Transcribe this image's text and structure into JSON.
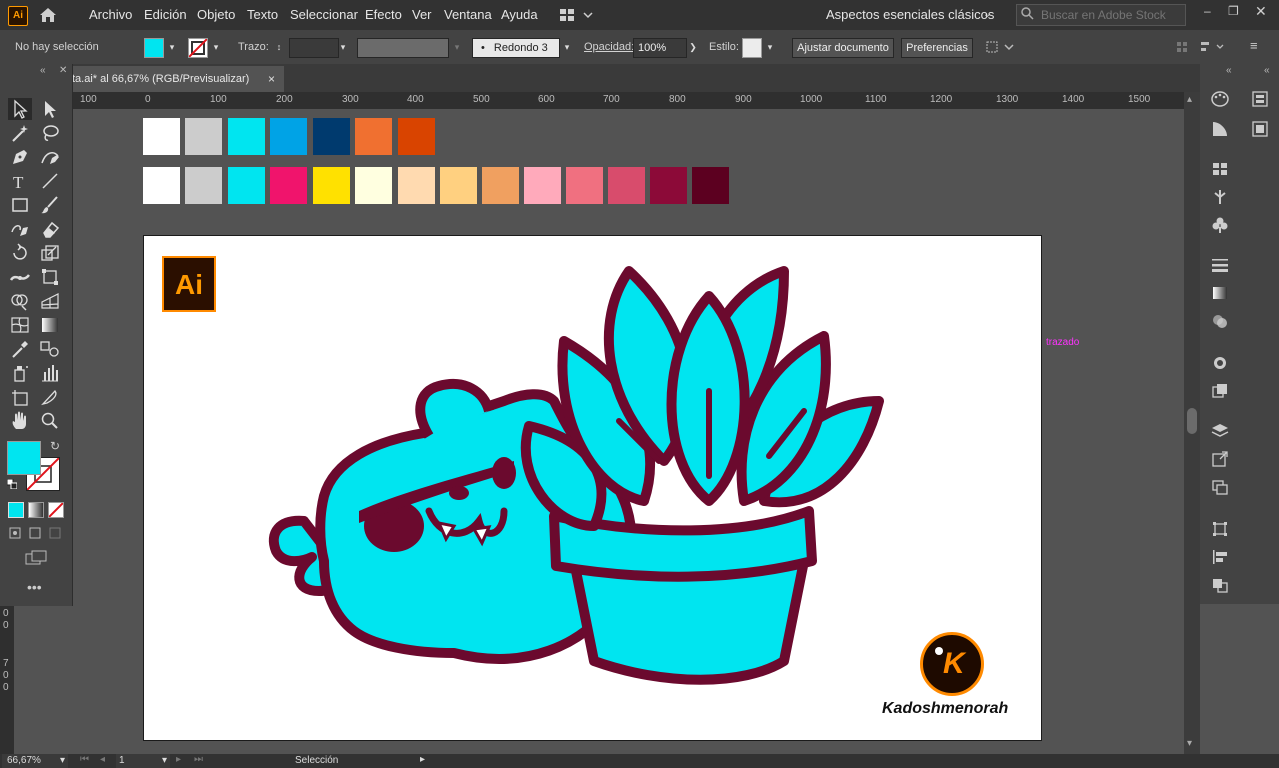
{
  "menubar": {
    "app_logo": "Ai",
    "items": [
      "Archivo",
      "Edición",
      "Objeto",
      "Texto",
      "Seleccionar",
      "Efecto",
      "Ver",
      "Ventana",
      "Ayuda"
    ],
    "workspace": "Aspectos esenciales clásicos",
    "search_placeholder": "Buscar en Adobe Stock"
  },
  "controlbar": {
    "selection_status": "No hay selección",
    "fill_color": "#00e5f0",
    "stroke_label": "Trazo:",
    "brush_value": "Redondo 3 ...",
    "opacity_label": "Opacidad:",
    "opacity_value": "100%",
    "style_label": "Estilo:",
    "fit_document_button": "Ajustar documento",
    "preferences_button": "Preferencias"
  },
  "document": {
    "tab_title": "ta.ai* al 66,67% (RGB/Previsualizar)",
    "tab_close": "×"
  },
  "ruler": {
    "labels": [
      "100",
      "0",
      "100",
      "200",
      "300",
      "400",
      "500",
      "600",
      "700",
      "800",
      "900",
      "1000",
      "1100",
      "1200",
      "1300",
      "1400",
      "1500"
    ],
    "vertical_labels": [
      "0",
      "0",
      "7",
      "0",
      "0"
    ]
  },
  "swatches": {
    "row1": [
      "#ffffff",
      "#cccccc",
      "#00e5f0",
      "#00a3e6",
      "#003a6e",
      "#f07030",
      "#d94400"
    ],
    "row2": [
      "#ffffff",
      "#cccccc",
      "#00e5f0",
      "#f0146c",
      "#ffe100",
      "#ffffe0",
      "#ffdab0",
      "#ffd080",
      "#f0a060",
      "#ffaabb",
      "#f07080",
      "#d84c6c",
      "#8c0a38",
      "#5c0020"
    ]
  },
  "artwork": {
    "ai_logo": "Ai",
    "hover_label": "trazado",
    "brand_letter": "K",
    "brand_name": "Kadoshmenorah",
    "outline_color": "#6b0a2e",
    "fill_color": "#00e5f0"
  },
  "statusbar": {
    "zoom": "66,67%",
    "artboard_number": "1",
    "tool_name": "Selección"
  }
}
